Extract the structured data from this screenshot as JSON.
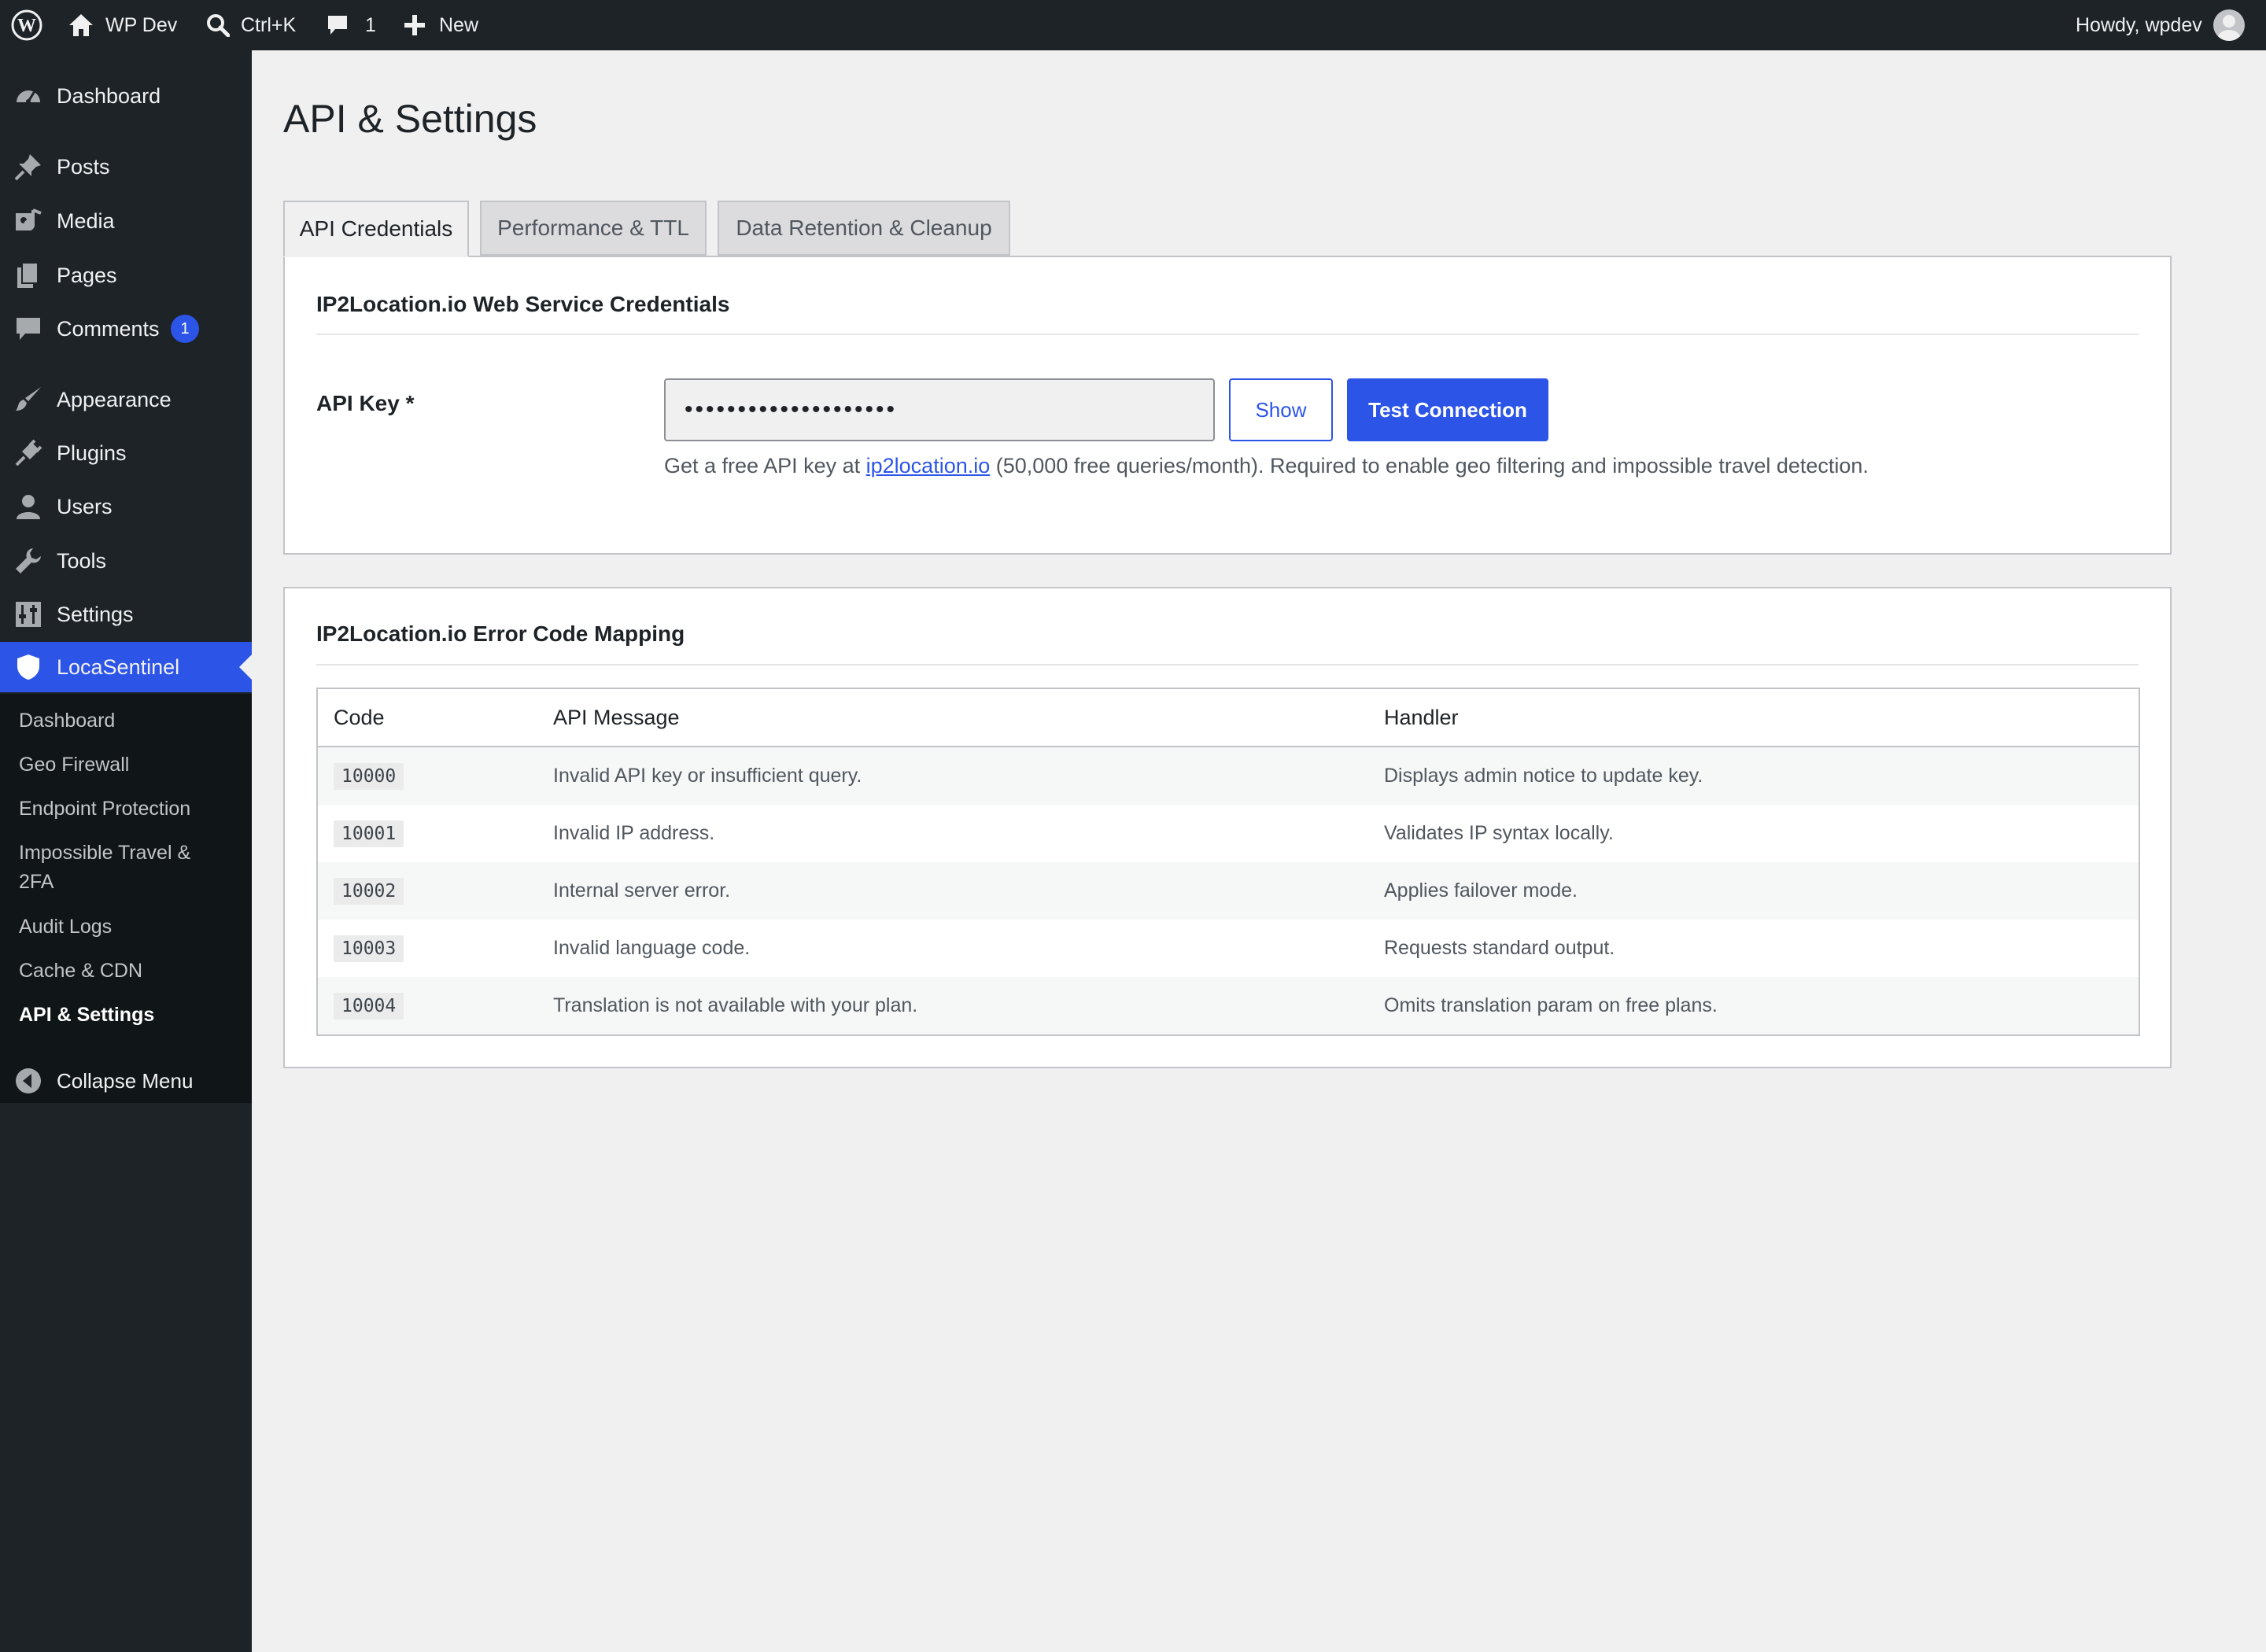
{
  "adminbar": {
    "site_name": "WP Dev",
    "search_shortcut": "Ctrl+K",
    "comments_count": "1",
    "new_label": "New",
    "greeting": "Howdy, wpdev"
  },
  "sidebar": {
    "items": [
      {
        "label": "Dashboard",
        "icon": "dashboard-icon"
      },
      {
        "label": "Posts",
        "icon": "pin-icon"
      },
      {
        "label": "Media",
        "icon": "media-icon"
      },
      {
        "label": "Pages",
        "icon": "pages-icon"
      },
      {
        "label": "Comments",
        "icon": "comment-icon",
        "badge": "1"
      },
      {
        "label": "Appearance",
        "icon": "brush-icon"
      },
      {
        "label": "Plugins",
        "icon": "plug-icon"
      },
      {
        "label": "Users",
        "icon": "user-icon"
      },
      {
        "label": "Tools",
        "icon": "wrench-icon"
      },
      {
        "label": "Settings",
        "icon": "sliders-icon"
      },
      {
        "label": "LocaSentinel",
        "icon": "shield-icon"
      }
    ],
    "submenu": [
      "Dashboard",
      "Geo Firewall",
      "Endpoint Protection",
      "Impossible Travel & 2FA",
      "Audit Logs",
      "Cache & CDN",
      "API & Settings"
    ],
    "collapse_label": "Collapse Menu"
  },
  "main": {
    "title": "API & Settings",
    "tabs": [
      "API Credentials",
      "Performance & TTL",
      "Data Retention & Cleanup"
    ],
    "credentials": {
      "title": "IP2Location.io Web Service Credentials",
      "api_key_label": "API Key *",
      "api_key_value": "••••••••••••••••••••",
      "show_label": "Show",
      "test_label": "Test Connection",
      "desc_before": "Get a free API key at ",
      "desc_link": "ip2location.io",
      "desc_after": " (50,000 free queries/month). Required to enable geo filtering and impossible travel detection."
    },
    "error_mapping": {
      "title": "IP2Location.io Error Code Mapping",
      "headers": [
        "Code",
        "API Message",
        "Handler"
      ],
      "rows": [
        {
          "code": "10000",
          "message": "Invalid API key or insufficient query.",
          "handler": "Displays admin notice to update key."
        },
        {
          "code": "10001",
          "message": "Invalid IP address.",
          "handler": "Validates IP syntax locally."
        },
        {
          "code": "10002",
          "message": "Internal server error.",
          "handler": "Applies failover mode."
        },
        {
          "code": "10003",
          "message": "Invalid language code.",
          "handler": "Requests standard output."
        },
        {
          "code": "10004",
          "message": "Translation is not available with your plan.",
          "handler": "Omits translation param on free plans."
        }
      ]
    }
  },
  "colors": {
    "accent": "#2c55e8",
    "sidebar_bg": "#1d2327",
    "submenu_bg": "#101517",
    "page_bg": "#f0f0f1"
  }
}
